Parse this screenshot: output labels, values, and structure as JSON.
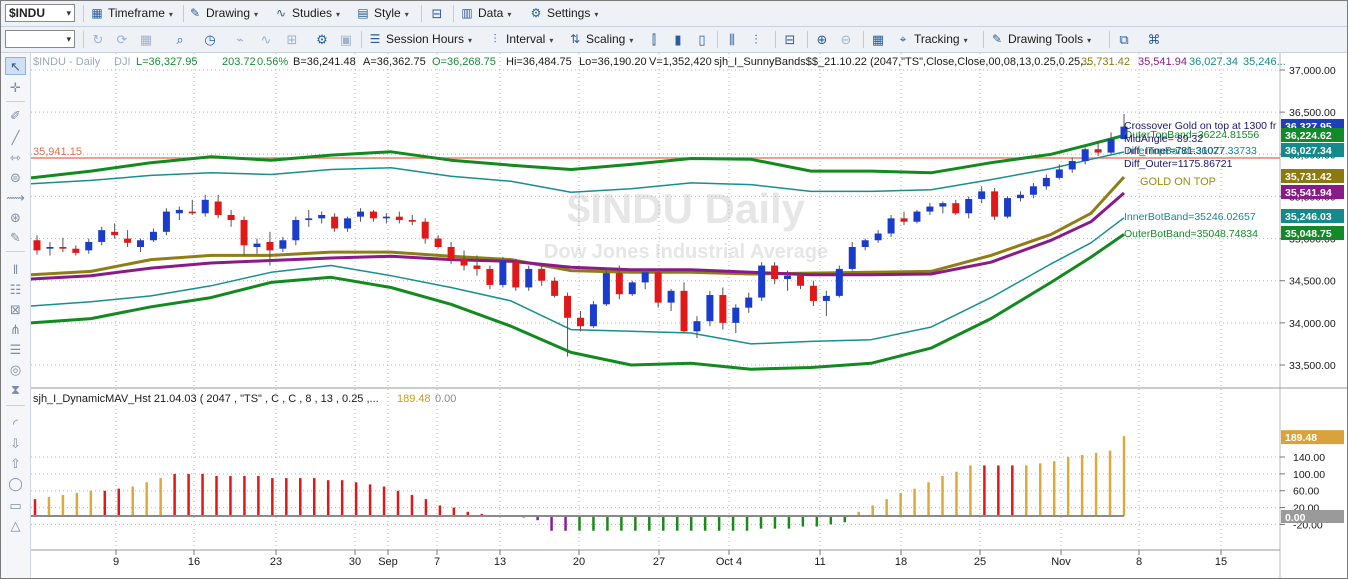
{
  "toolbar1": {
    "symbol": "$INDU",
    "timeframe": "Timeframe",
    "drawing": "Drawing",
    "studies": "Studies",
    "style": "Style",
    "data": "Data",
    "settings": "Settings"
  },
  "toolbar2": {
    "session_hours": "Session Hours",
    "interval": "Interval",
    "scaling": "Scaling",
    "tracking": "Tracking",
    "drawing_tools": "Drawing Tools"
  },
  "price_panel": {
    "watermark_title": "$INDU Daily",
    "watermark_subtitle": "Dow Jones Industrial Average",
    "header_symbol": "$INDU - Daily",
    "header_exchange": "DJI",
    "header_last": "L=36,327.95",
    "header_change": "203.72",
    "header_change_pct": "0.56%",
    "header_bid": "B=36,241.48",
    "header_ask": "A=36,362.75",
    "header_open": "O=36,268.75",
    "header_high": "Hi=36,484.75",
    "header_low": "Lo=36,190.20",
    "header_volume": "V=1,352,420",
    "header_study": "sjh_I_SunnyBands$$_21.10.22 (2047,\"TS\",Close,Close,00,08,13,0.25,0.25,...",
    "header_vals": [
      "35,731.42",
      "35,541.94",
      "36,027.34",
      "35,246..."
    ],
    "ref_line_label": "35,941.15",
    "annotations": {
      "crossover": "Crossover Gold on top at 1300 fr",
      "outer_top": "OuterTopBand=36224.81556",
      "mid_angle": "MidAngle= 89.32",
      "diff_inner": "Diff_Inner=781.31077",
      "inner_top": "InnerTopBand=36027.33733",
      "diff_outer": "Diff_Outer=1175.86721",
      "gold_on_top": "GOLD ON TOP",
      "inner_bot": "InnerBotBand=35246.02657",
      "outer_bot": "OuterBotBand=35048.74834"
    },
    "y_ticks": [
      "37,000.00",
      "36,500.00",
      "36,000.00",
      "35,500.00",
      "35,000.00",
      "34,500.00",
      "34,000.00",
      "33,500.00"
    ],
    "price_tags": [
      {
        "label": "36,327.95",
        "color": "#1f3fb8"
      },
      {
        "label": "36,224.62",
        "color": "#138a2a"
      },
      {
        "label": "36,027.34",
        "color": "#148a8a"
      },
      {
        "label": "35,731.42",
        "color": "#8a7a10"
      },
      {
        "label": "35,541.94",
        "color": "#8a1a8a"
      },
      {
        "label": "35,246.03",
        "color": "#148a8a"
      },
      {
        "label": "35,048.75",
        "color": "#138a2a"
      }
    ]
  },
  "indicator_panel": {
    "title": "sjh_I_DynamicMAV_Hst 21.04.03 ( 2047 , \"TS\" , C , C ,  8 , 13 , 0.25 ,...",
    "val1": "189.48",
    "val2": "0.00",
    "y_ticks": [
      "140.00",
      "100.00",
      "60.00",
      "20.00",
      "-20.00"
    ],
    "tag_value": "189.48",
    "tag_zero": "0.00"
  },
  "x_axis": {
    "ticks": [
      "9",
      "16",
      "23",
      "30",
      "Sep",
      "7",
      "13",
      "20",
      "27",
      "Oct 4",
      "11",
      "18",
      "25",
      "Nov",
      "8",
      "15"
    ]
  },
  "colors": {
    "up": "#1a3ccc",
    "down": "#e01818",
    "outer_band": "#128a1f",
    "inner_band": "#178f8f",
    "gold": "#8f7d15",
    "purple": "#8a1a8a",
    "ref_line": "#f08060",
    "hist_red": "#e01818",
    "hist_gold": "#dca93a",
    "hist_green": "#1a8a1a",
    "hist_purple": "#8a1a9a"
  },
  "chart_data": [
    {
      "type": "line",
      "title": "$INDU - Daily",
      "ylim": [
        33300,
        37100
      ],
      "x": [
        "9",
        "16",
        "23",
        "30",
        "Sep",
        "7",
        "13",
        "20",
        "27",
        "Oct 4",
        "11",
        "18",
        "25",
        "Nov",
        "8",
        "15"
      ],
      "series": [
        {
          "name": "OuterTopBand",
          "values": [
            35830,
            35990,
            35930,
            36060,
            35920,
            35810,
            35990,
            35900,
            35810,
            35880,
            35820,
            35880,
            36020,
            36224
          ]
        },
        {
          "name": "InnerTopBand",
          "values": [
            35650,
            35800,
            35720,
            35850,
            35700,
            35560,
            35680,
            35560,
            35420,
            35560,
            35620,
            35700,
            35860,
            36027
          ]
        },
        {
          "name": "OuterBotBand",
          "values": [
            34000,
            34270,
            34400,
            34520,
            34420,
            34160,
            33720,
            33550,
            33450,
            33480,
            33740,
            34250,
            34700,
            35049
          ]
        },
        {
          "name": "InnerBotBand",
          "values": [
            34200,
            34450,
            34560,
            34710,
            34610,
            34390,
            33920,
            33790,
            33740,
            33800,
            34030,
            34510,
            34930,
            35246
          ]
        },
        {
          "name": "GOLD ON TOP",
          "values": [
            34600,
            34850,
            34980,
            34990,
            34960,
            34720,
            34640,
            34600,
            34580,
            34600,
            34720,
            35100,
            35380,
            35731
          ]
        },
        {
          "name": "sjh_I_DynamicMAV_Hst",
          "values": [
            40,
            60,
            95,
            100,
            80,
            40,
            -5,
            -30,
            -35,
            -20,
            -10,
            80,
            130,
            189.48
          ]
        }
      ]
    }
  ]
}
